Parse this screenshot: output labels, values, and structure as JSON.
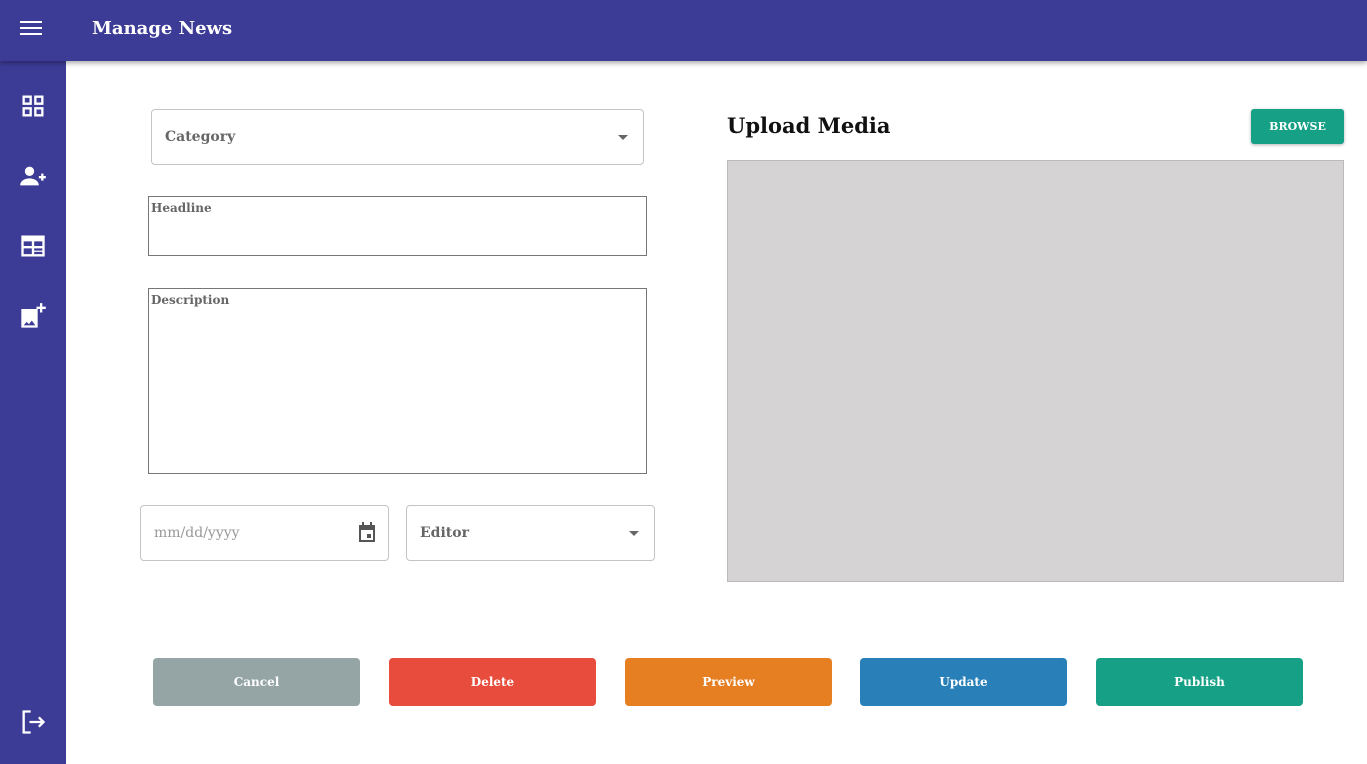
{
  "header": {
    "title": "Manage News",
    "menu_icon": "hamburger-icon"
  },
  "sidebar": {
    "items": [
      {
        "icon": "dashboard-icon"
      },
      {
        "icon": "person-add-icon"
      },
      {
        "icon": "news-icon"
      },
      {
        "icon": "add-photo-icon"
      },
      {
        "icon": "logout-icon"
      }
    ]
  },
  "form": {
    "category_placeholder": "Category",
    "headline_placeholder": "Headline",
    "description_placeholder": "Description",
    "date_placeholder": "mm/dd/yyyy",
    "editor_placeholder": "Editor"
  },
  "media": {
    "title": "Upload Media",
    "browse_label": "BROWSE"
  },
  "actions": [
    {
      "label": "Cancel",
      "color": "#95a5a6"
    },
    {
      "label": "Delete",
      "color": "#e74c3c"
    },
    {
      "label": "Preview",
      "color": "#e67e22"
    },
    {
      "label": "Update",
      "color": "#2980b9"
    },
    {
      "label": "Publish",
      "color": "#16a085"
    }
  ]
}
